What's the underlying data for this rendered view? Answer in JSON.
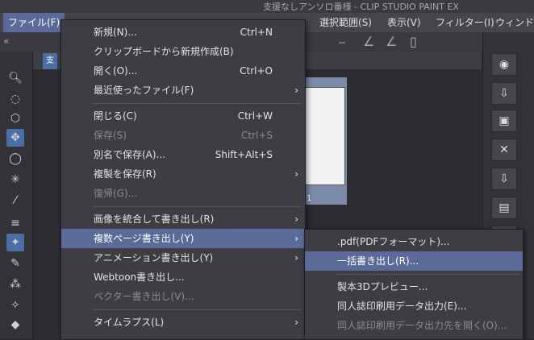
{
  "window": {
    "title": "支援なしアンソロ番様 - CLIP STUDIO PAINT EX"
  },
  "menubar": {
    "file": "ファイル(F)",
    "select": "選択範囲(S)",
    "view": "表示(V)",
    "filter": "フィルター(I)",
    "window": "ウィンドウ("
  },
  "canvas": {
    "tab_label": "支",
    "page_number": "1"
  },
  "file_menu": {
    "items": [
      {
        "label": "新規(N)...",
        "shortcut": "Ctrl+N"
      },
      {
        "label": "クリップボードから新規作成(B)"
      },
      {
        "label": "開く(O)...",
        "shortcut": "Ctrl+O"
      },
      {
        "label": "最近使ったファイル(F)",
        "submenu": "›"
      },
      {
        "label": "閉じる(C)",
        "shortcut": "Ctrl+W"
      },
      {
        "label": "保存(S)",
        "shortcut": "Ctrl+S"
      },
      {
        "label": "別名で保存(A)...",
        "shortcut": "Shift+Alt+S"
      },
      {
        "label": "複製を保存(R)",
        "submenu": "›"
      },
      {
        "label": "復帰(G)..."
      },
      {
        "label": "画像を統合して書き出し(R)",
        "submenu": "›"
      },
      {
        "label": "複数ページ書き出し(Y)",
        "submenu": "›"
      },
      {
        "label": "アニメーション書き出し(Y)",
        "submenu": "›"
      },
      {
        "label": "Webtoon書き出し..."
      },
      {
        "label": "ベクター書き出し(V)..."
      },
      {
        "label": "タイムラプス(L)",
        "submenu": "›"
      }
    ]
  },
  "submenu": {
    "items": [
      {
        "label": ".pdf(PDFフォーマット)..."
      },
      {
        "label": "一括書き出し(R)..."
      },
      {
        "label": "製本3Dプレビュー..."
      },
      {
        "label": "同人誌印刷用データ出力(E)..."
      },
      {
        "label": "同人誌印刷用データ出力先を開く(O)..."
      }
    ]
  },
  "colors": {
    "highlight": "#5b6b99",
    "menu_bg": "#3d3d43",
    "accent": "#4a6fa5"
  },
  "icons": [
    "zoom-icon",
    "lasso-icon",
    "move-icon",
    "eyedropper-icon",
    "pen-icon",
    "eraser-icon"
  ]
}
